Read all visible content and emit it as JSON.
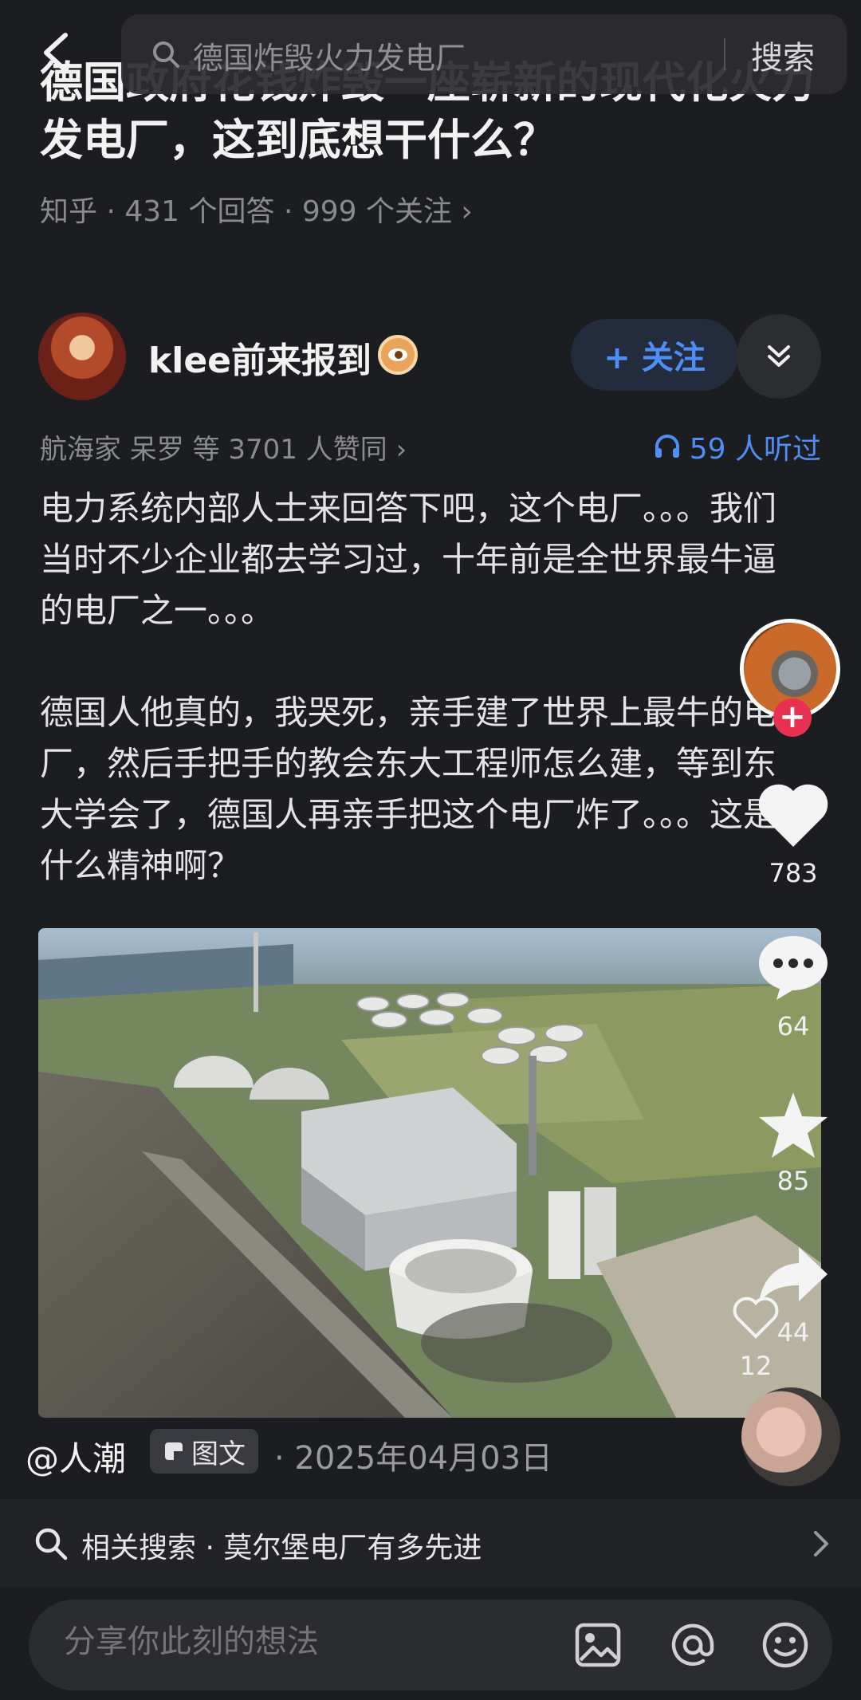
{
  "search": {
    "query": "德国炸毁火力发电厂",
    "button_label": "搜索"
  },
  "question": {
    "title": "德国政府花钱炸毁一座崭新的现代化火力发电厂，这到底想干什么？",
    "meta": "知乎 · 431 个回答 · 999 个关注 ›"
  },
  "author": {
    "name": "klee前来报到",
    "follow_label": "+ 关注",
    "likes_text": "航海家 呆罗 等 3701 人赞同 ›",
    "listen_text": "59 人听过"
  },
  "answer": {
    "paragraphs": [
      "电力系统内部人士来回答下吧，这个电厂。。。我们当时不少企业都去学习过，十年前是全世界最牛逼的电厂之一。。。",
      "德国人他真的，我哭死，亲手建了世界上最牛的电厂，然后手把手的教会东大工程师怎么建，等到东大学会了，德国人再亲手把这个电厂炸了。。。这是什么精神啊？"
    ]
  },
  "rail": {
    "like_count": "783",
    "comment_count": "64",
    "favorite_count": "85",
    "share_count": "44",
    "small_like_count": "12"
  },
  "post": {
    "author_tag": "@人潮",
    "type_label": "图文",
    "date": "· 2025年04月03日"
  },
  "related": {
    "text": "相关搜索 · 莫尔堡电厂有多先进"
  },
  "composer": {
    "placeholder": "分享你此刻的想法"
  }
}
